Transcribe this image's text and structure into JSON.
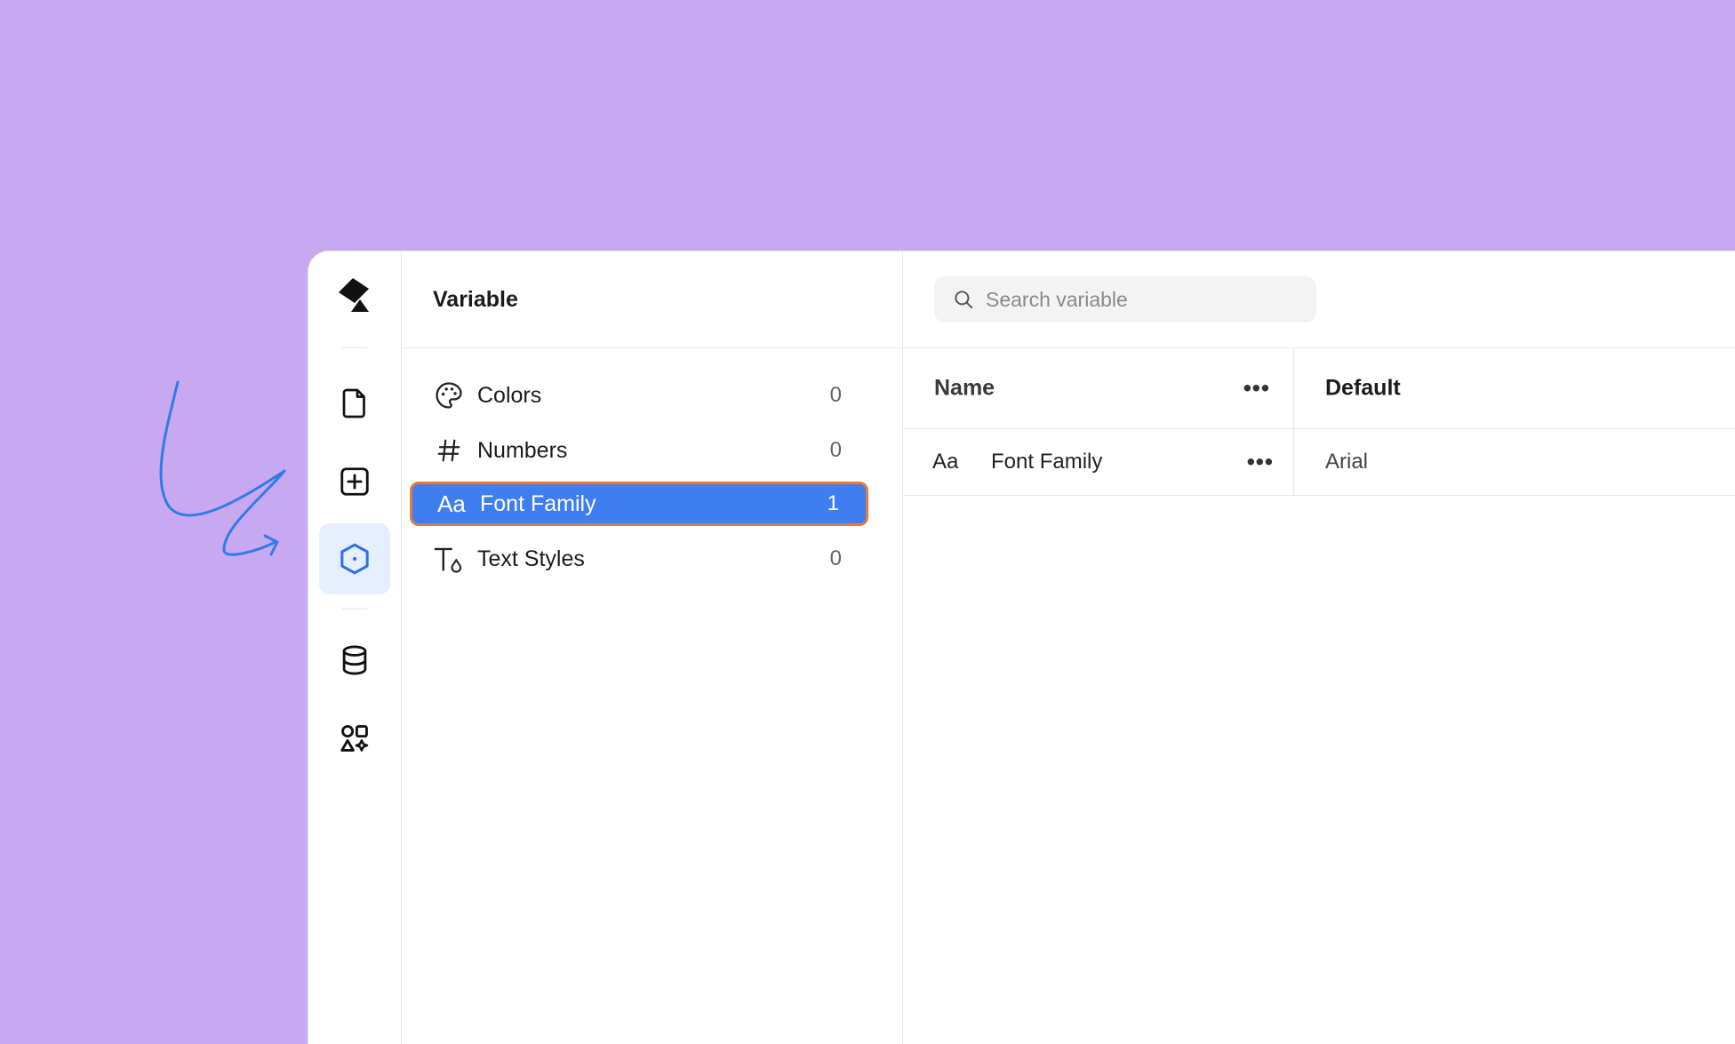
{
  "sidebar_rail": {
    "items": [
      {
        "icon": "file-icon"
      },
      {
        "icon": "plus-square-icon"
      },
      {
        "icon": "hexagon-icon",
        "active": true
      },
      {
        "icon": "database-icon"
      },
      {
        "icon": "shapes-icon"
      }
    ]
  },
  "variables_panel": {
    "title": "Variable",
    "items": [
      {
        "icon": "palette-icon",
        "label": "Colors",
        "count": "0"
      },
      {
        "icon": "hash-icon",
        "label": "Numbers",
        "count": "0"
      },
      {
        "icon": "font-family-icon",
        "icon_text": "Aa",
        "label": "Font Family",
        "count": "1",
        "selected": true
      },
      {
        "icon": "text-styles-icon",
        "label": "Text Styles",
        "count": "0"
      }
    ]
  },
  "main": {
    "search": {
      "placeholder": "Search variable",
      "value": ""
    },
    "table": {
      "columns": [
        {
          "label": "Name"
        },
        {
          "label": "Default"
        }
      ],
      "more_label": "•••",
      "rows": [
        {
          "icon_text": "Aa",
          "name": "Font Family",
          "default": "Arial"
        }
      ]
    }
  },
  "colors": {
    "background": "#c9a8f2",
    "accent": "#3f7ef0",
    "selection_border": "#e47a3a",
    "annotation": "#2f7bea"
  }
}
